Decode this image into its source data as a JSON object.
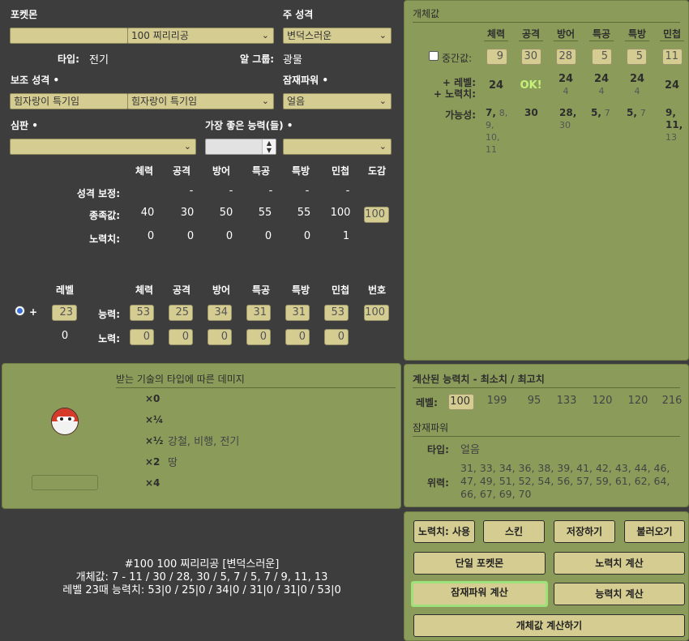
{
  "pokemon_label": "포켓몬",
  "pokemon_select": "100 찌리리공",
  "nature_label": "주 성격",
  "nature_select": "변덕스러운",
  "type_label": "타입:",
  "type_value": "전기",
  "egg_label": "알 그룹:",
  "egg_value": "광물",
  "subnature_label": "보조 성격 •",
  "characteristic_a": "힘자랑이 특기임",
  "characteristic_b": "힘자랑이 특기임",
  "hp_type_label": "잠재파워 •",
  "hp_type_select": "얼음",
  "judge_label": "심판 •",
  "judge_select": "",
  "best_stat_label": "가장 좋은 능력(들) •",
  "best_stat_select": "",
  "stat_headers": [
    "체력",
    "공격",
    "방어",
    "특공",
    "특방",
    "민첩"
  ],
  "dex_label": "도감",
  "row_nature_label": "성격 보정:",
  "nature_mods": [
    "",
    "-",
    "-",
    "-",
    "-",
    "-"
  ],
  "row_base_label": "종족값:",
  "base_stats": [
    "40",
    "30",
    "50",
    "55",
    "55",
    "100"
  ],
  "dex_value": "100",
  "row_ev_label": "노력치:",
  "ev_yield": [
    "0",
    "0",
    "0",
    "0",
    "0",
    "1"
  ],
  "level_label": "레벨",
  "number_label": "번호",
  "plus_label": "+",
  "level_value": "23",
  "stats_label": "능력:",
  "stats_values": [
    "53",
    "25",
    "34",
    "31",
    "31",
    "53"
  ],
  "number_value": "100",
  "ev_level": "0",
  "effort_label": "노력:",
  "effort_values": [
    "0",
    "0",
    "0",
    "0",
    "0",
    "0"
  ],
  "iv_panel": {
    "title": "개체값",
    "mid_label": "중간값:",
    "mid_values": [
      "9",
      "30",
      "28",
      "5",
      "5",
      "11"
    ],
    "plus_level_label": "+ 레벨:",
    "plus_ev_label": "+ 노력치:",
    "level_row": [
      "24",
      "OK!",
      "24",
      "24",
      "24",
      "24"
    ],
    "level_row_sub": [
      "",
      "",
      "4",
      "4",
      "4",
      ""
    ],
    "possible_label": "가능성:",
    "possible": [
      {
        "main": "7,",
        "sub": "8, 9, 10, 11"
      },
      {
        "main": "30",
        "sub": ""
      },
      {
        "main": "28,",
        "sub": "30"
      },
      {
        "main": "5,",
        "sub": "7"
      },
      {
        "main": "5,",
        "sub": "7"
      },
      {
        "main": "9, 11,",
        "sub": "13"
      }
    ]
  },
  "damage_panel": {
    "title": "받는 기술의 타입에 따른 데미지",
    "rows": [
      {
        "mult": "×0",
        "types": ""
      },
      {
        "mult": "×¼",
        "types": ""
      },
      {
        "mult": "×½",
        "types": "강철, 비행, 전기"
      },
      {
        "mult": "×2",
        "types": "땅"
      },
      {
        "mult": "×4",
        "types": ""
      }
    ]
  },
  "calc_panel": {
    "title": "계산된 능력치 - 최소치 / 최고치",
    "level_label": "레벨:",
    "level_value": "100",
    "values": [
      "199",
      "95",
      "133",
      "120",
      "120",
      "216"
    ],
    "hp_title": "잠재파워",
    "type_label": "타입:",
    "type_value": "얼음",
    "power_label": "위력:",
    "power_lines": [
      "31, 33, 34, 36, 38, 39, 41, 42, 43, 44, 46,",
      "47, 49, 51, 52, 54, 56, 57, 59, 61, 62, 64,",
      "66, 67, 69, 70"
    ]
  },
  "summary": {
    "line1": "#100 100 찌리리공 [변덕스러운]",
    "line2": "개체값: 7 - 11 / 30 / 28, 30 / 5, 7 / 5, 7 / 9, 11, 13",
    "line3": "레벨 23때 능력치: 53|0 / 25|0 / 34|0 / 31|0 / 31|0 / 53|0"
  },
  "buttons": {
    "ev_use": "노력치: 사용",
    "skin": "스킨",
    "save": "저장하기",
    "load": "불러오기",
    "single": "단일 포켓몬",
    "ev_calc": "노력치 계산",
    "hp_calc": "잠재파워 계산",
    "stat_calc": "능력치 계산",
    "iv_calc": "개체값 계산하기"
  },
  "colors": {
    "panel": "#8b9c5a",
    "field": "#d5cc91",
    "background": "#3d3d3d",
    "highlight": "#9ee07a"
  }
}
